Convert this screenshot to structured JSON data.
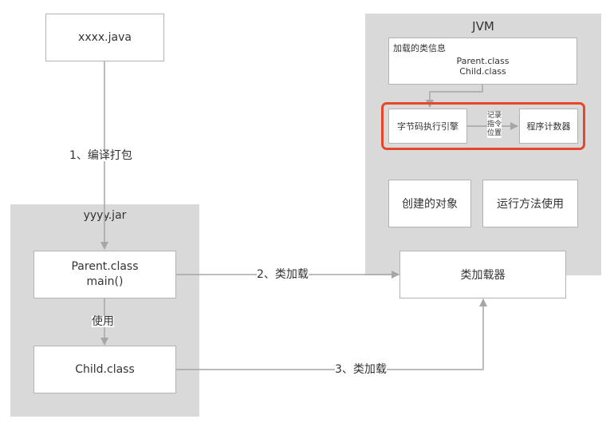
{
  "nodes": {
    "source_file": "xxxx.java",
    "jar": {
      "title": "yyyy.jar",
      "parent_class": [
        "Parent.class",
        "main()"
      ],
      "child_class": "Child.class"
    },
    "jvm": {
      "title": "JVM",
      "loaded_class_info": {
        "heading": "加载的类信息",
        "items": [
          "Parent.class",
          "Child.class"
        ]
      },
      "bytecode_engine": "字节码执行引擎",
      "program_counter": "程序计数器",
      "created_objects": "创建的对象",
      "method_runtime": "运行方法使用",
      "class_loader": "类加载器"
    }
  },
  "edges": {
    "compile_package": "1、编译打包",
    "uses": "使用",
    "class_load_2": "2、类加载",
    "class_load_3": "3、类加载",
    "record_position": [
      "记录",
      "指令",
      "位置"
    ]
  },
  "colors": {
    "highlight": "#e8462b",
    "region": "#d9d9d9",
    "line": "#a6a6a6"
  }
}
